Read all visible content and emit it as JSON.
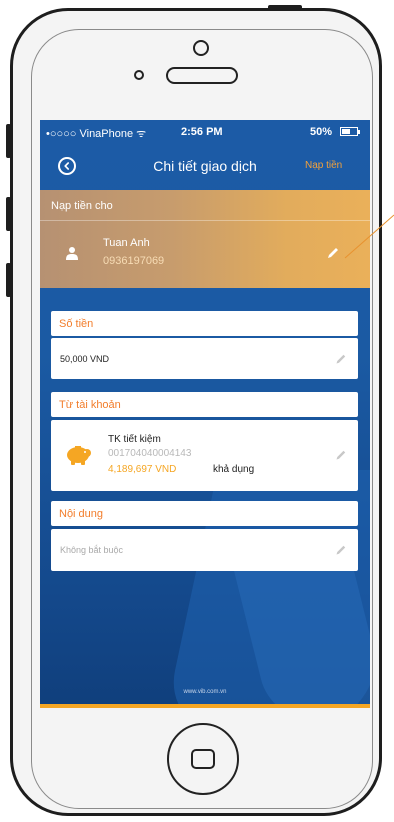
{
  "status_bar": {
    "carrier": "•○○○○ VinaPhone ᯤ",
    "time": "2:56 PM",
    "battery": "50%"
  },
  "nav": {
    "title": "Chi tiết giao dịch",
    "action": "Nạp tiền",
    "back_icon": "circle-chevron-left"
  },
  "recipient": {
    "header": "Nạp tiền cho",
    "name": "Tuan Anh",
    "phone": "0936197069"
  },
  "amount": {
    "label": "Số tiền",
    "value": "50,000 VND"
  },
  "source_account": {
    "label": "Từ tài khoản",
    "name": "TK tiết kiệm",
    "number": "001704040004143",
    "balance": "4,189,697 VND",
    "balance_suffix": "khả dụng"
  },
  "content": {
    "label": "Nội dung",
    "placeholder": "Không bắt buộc"
  },
  "footer": {
    "url": "www.vib.com.vn"
  },
  "colors": {
    "accent_orange": "#f27d2b",
    "nav_action": "#f4a23b",
    "balance": "#f5a623",
    "screen_blue": "#1b5aa3"
  }
}
